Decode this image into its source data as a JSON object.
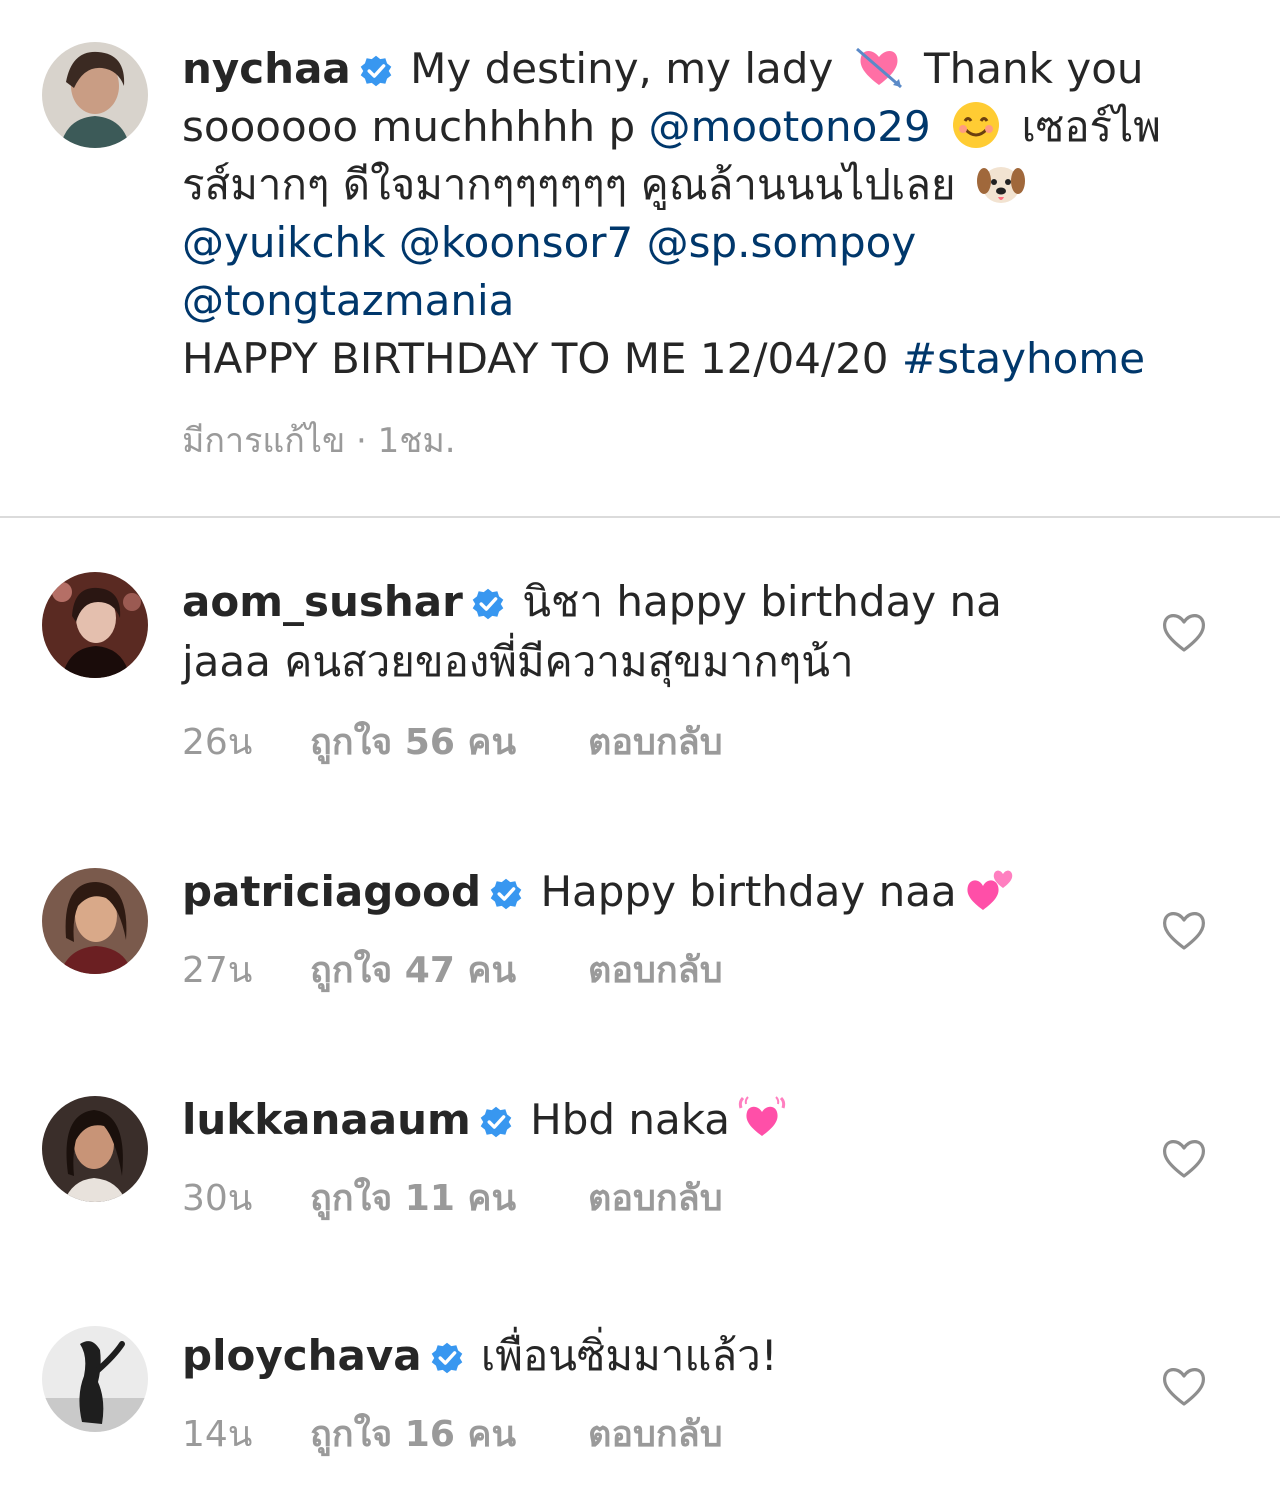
{
  "caption": {
    "username": "nychaа",
    "line1": "My destiny, my lady",
    "line1_end": "Thank you",
    "line2_start": "soooooo muchhhhh p",
    "mention_mootono": "@mootono29",
    "line2_end": "เซอร์ไพ",
    "line3": "รส์มากๆ ดีใจมากๆๆๆๆๆๆ คูณล้านนนไปเลย",
    "line4_mentions": "@yuikchk @koonsor7 @sp.sompoy",
    "line5_mentions": "@tongtazmania",
    "line6_text": "HAPPY BIRTHDAY TO ME 12/04/20",
    "hashtag": "#stayhome",
    "meta": "มีการแก้ไข · 1ชม."
  },
  "comments": [
    {
      "username": "aom_sushar",
      "text_line1": "นิชา happy birthday na",
      "text_line2": "jaaa คนสวยของพี่มีความสุขมากๆน้า",
      "time": "26น",
      "likes": "ถูกใจ 56 คน",
      "reply": "ตอบกลับ"
    },
    {
      "username": "patriciagood",
      "text_line1": "Happy birthday naa",
      "time": "27น",
      "likes": "ถูกใจ 47 คน",
      "reply": "ตอบกลับ"
    },
    {
      "username": "lukkanaaum",
      "text_line1": "Hbd naka",
      "time": "30น",
      "likes": "ถูกใจ 11 คน",
      "reply": "ตอบกลับ"
    },
    {
      "username": "ploychava",
      "text_line1": "เพื่อนซิ่มมาแล้ว!",
      "time": "14น",
      "likes": "ถูกใจ 16 คน",
      "reply": "ตอบกลับ"
    }
  ],
  "colors": {
    "text": "#262626",
    "mention": "#00376b",
    "meta": "#9a9a9a",
    "verified": "#3897f0",
    "divider": "#dbdbdb"
  },
  "icons": {
    "verified": "verified-badge-icon",
    "heart": "heart-outline-icon",
    "heart_arrow": "heart-with-arrow-emoji",
    "smile": "smiling-face-emoji",
    "dog": "dog-face-emoji",
    "pink_hearts": "two-hearts-emoji",
    "growing_heart": "growing-heart-emoji"
  }
}
